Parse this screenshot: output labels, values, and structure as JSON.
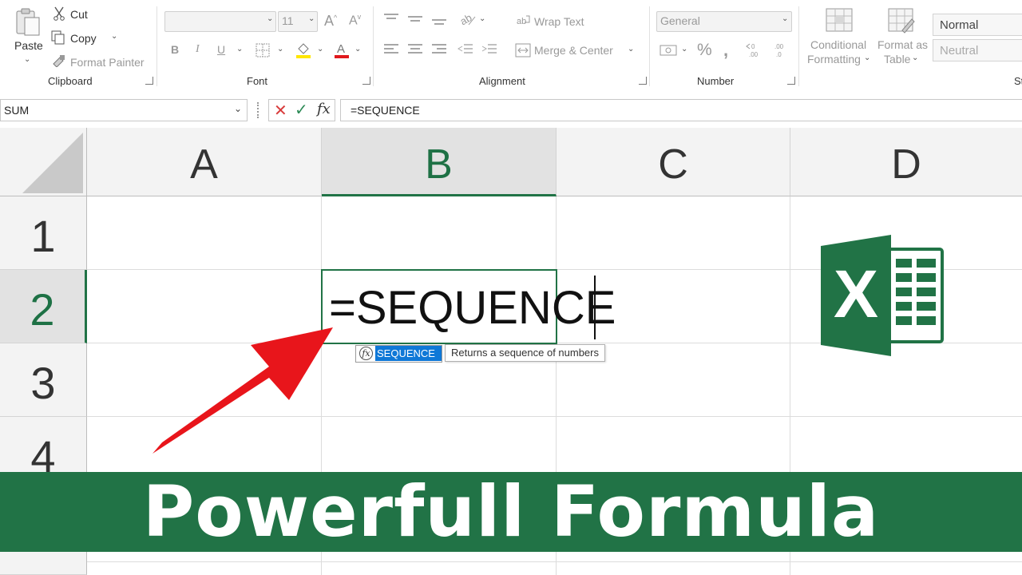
{
  "ribbon": {
    "clipboard": {
      "paste": "Paste",
      "cut": "Cut",
      "copy": "Copy",
      "format_painter": "Format Painter",
      "label": "Clipboard"
    },
    "font": {
      "font_size": "11",
      "label": "Font"
    },
    "alignment": {
      "wrap_text": "Wrap Text",
      "merge_center": "Merge & Center",
      "label": "Alignment"
    },
    "number": {
      "format": "General",
      "label": "Number"
    },
    "styles": {
      "conditional_line1": "Conditional",
      "conditional_line2": "Formatting",
      "format_table_line1": "Format as",
      "format_table_line2": "Table",
      "normal": "Normal",
      "neutral": "Neutral",
      "label_partial": "St"
    }
  },
  "formula_bar": {
    "name_box": "SUM",
    "formula": "=SEQUENCE",
    "fx": "fx"
  },
  "grid": {
    "columns": [
      "A",
      "B",
      "C",
      "D"
    ],
    "rows": [
      "1",
      "2",
      "3",
      "4"
    ],
    "active_cell_text": "=SEQUENCE"
  },
  "autocomplete": {
    "item": "SEQUENCE",
    "tooltip": "Returns a sequence of numbers",
    "fx": "fx"
  },
  "logo": {
    "letter": "X"
  },
  "banner": {
    "text": "Powerfull Formula"
  },
  "colors": {
    "excel_green": "#217346",
    "arrow_red": "#e8151b",
    "selection_blue": "#0f78d7"
  }
}
